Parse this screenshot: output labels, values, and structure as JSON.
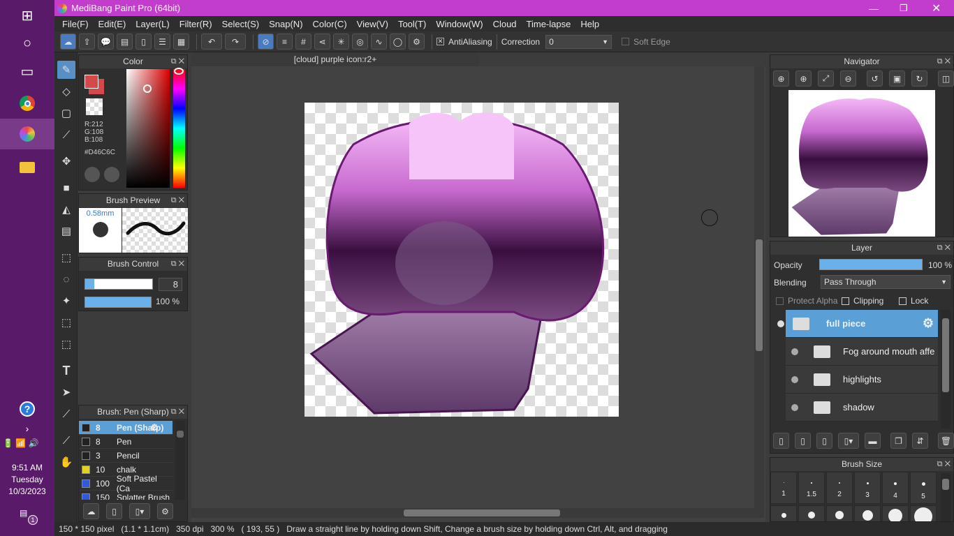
{
  "window_title": "MediBang Paint Pro (64bit)",
  "menu": [
    "File(F)",
    "Edit(E)",
    "Layer(L)",
    "Filter(R)",
    "Select(S)",
    "Snap(N)",
    "Color(C)",
    "View(V)",
    "Tool(T)",
    "Window(W)",
    "Cloud",
    "Time-lapse",
    "Help"
  ],
  "toolbar": {
    "antialiasing_label": "AntiAliasing",
    "correction_label": "Correction",
    "correction_value": "0",
    "soft_edge_label": "Soft Edge"
  },
  "document_tab": "[cloud] purple icon:r2+",
  "color_panel": {
    "title": "Color",
    "r": "R:212",
    "g": "G:108",
    "b": "B:108",
    "hex": "#D46C6C",
    "primary_color": "#d44a4a"
  },
  "brush_preview": {
    "title": "Brush Preview",
    "size": "0.58mm"
  },
  "brush_control": {
    "title": "Brush Control",
    "size_value": "8",
    "opacity_value": "100 %"
  },
  "brush_list": {
    "title": "Brush: Pen (Sharp)",
    "items": [
      {
        "size": "8",
        "name": "Pen (Sharp)",
        "color": "#222222"
      },
      {
        "size": "8",
        "name": "Pen",
        "color": "#222222"
      },
      {
        "size": "3",
        "name": "Pencil",
        "color": "#222222"
      },
      {
        "size": "10",
        "name": "chalk",
        "color": "#e6d21e"
      },
      {
        "size": "100",
        "name": "Soft Pastel (Ca",
        "color": "#2c5ae0"
      },
      {
        "size": "150",
        "name": "Splatter Brush",
        "color": "#2c5ae0"
      }
    ]
  },
  "navigator": {
    "title": "Navigator"
  },
  "layer_panel": {
    "title": "Layer",
    "opacity_label": "Opacity",
    "opacity_value": "100 %",
    "opacity_fraction": 1.0,
    "blending_label": "Blending",
    "blending_value": "Pass Through",
    "protect_alpha": "Protect Alpha",
    "clipping": "Clipping",
    "lock": "Lock",
    "layers": [
      "full piece",
      "Fog around mouth affe",
      "highlights",
      "shadow"
    ]
  },
  "brush_size_panel": {
    "title": "Brush Size",
    "sizes": [
      "1",
      "1.5",
      "2",
      "3",
      "4",
      "5"
    ]
  },
  "status": {
    "dimensions": "150 * 150 pixel",
    "cm": "(1.1 * 1.1cm)",
    "dpi": "350 dpi",
    "zoom": "300 %",
    "coords": "( 193, 55 )",
    "hint": "Draw a straight line by holding down Shift, Change a brush size by holding down Ctrl, Alt, and dragging"
  },
  "system": {
    "time": "9:51 AM",
    "day": "Tuesday",
    "date": "10/3/2023",
    "notification_count": "1"
  }
}
